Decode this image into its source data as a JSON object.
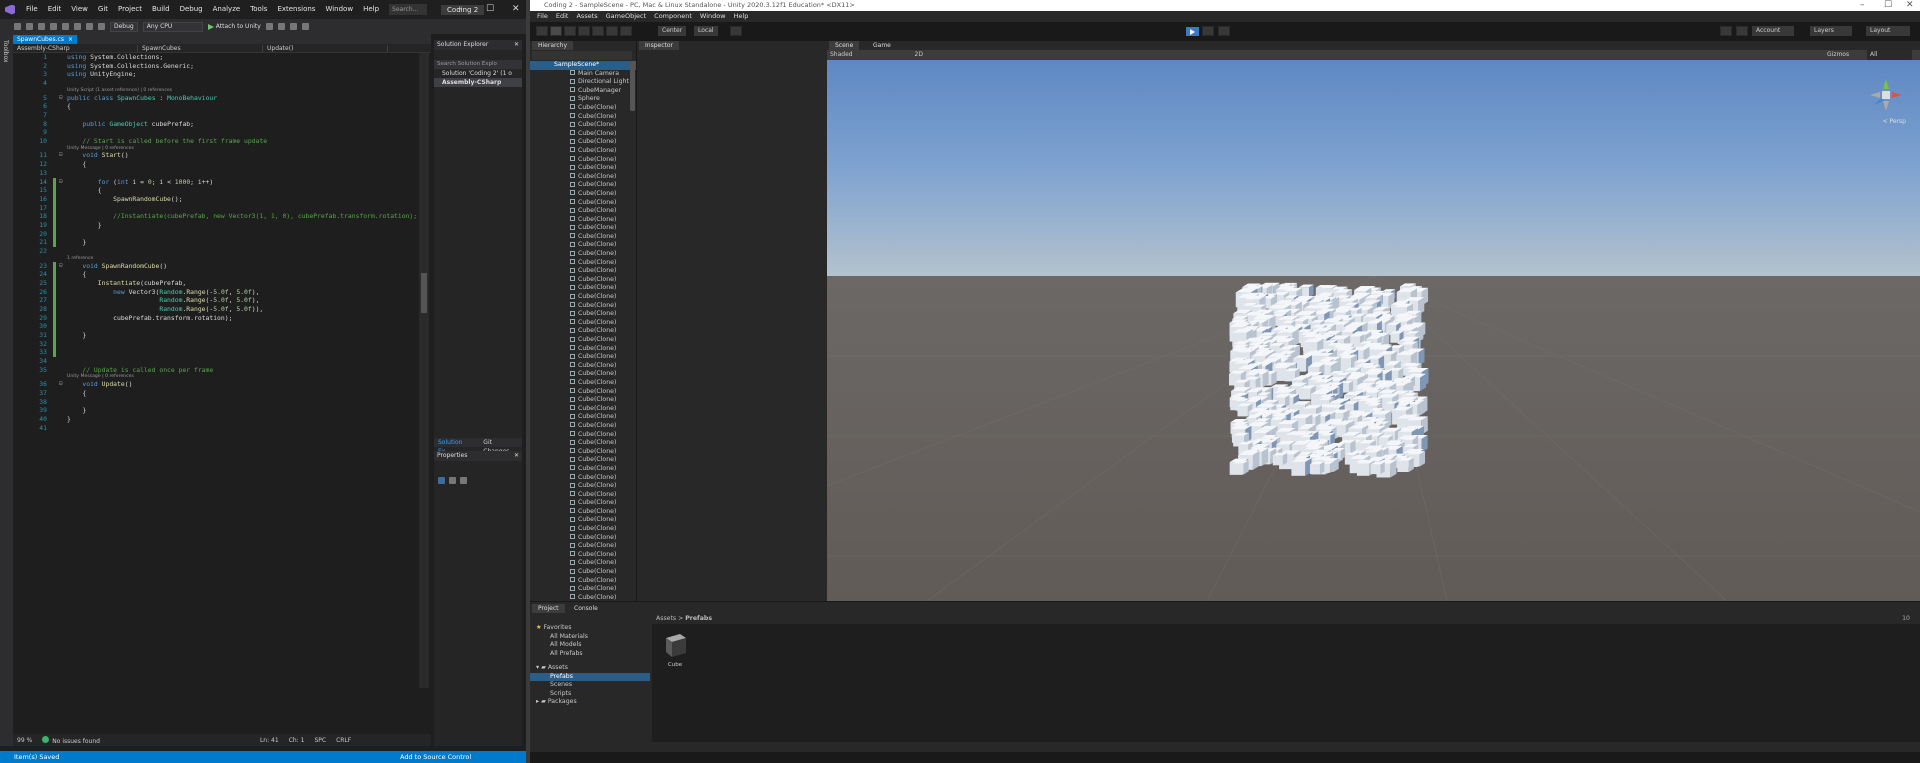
{
  "vs": {
    "menu": [
      "File",
      "Edit",
      "View",
      "Git",
      "Project",
      "Build",
      "Debug",
      "Analyze",
      "Tools",
      "Extensions",
      "Window",
      "Help"
    ],
    "search_placeholder": "Search...",
    "solution_name": "Coding 2",
    "toolbar": {
      "config": "Debug",
      "platform": "Any CPU",
      "attach": "Attach to Unity"
    },
    "toolbox_label": "Toolbox",
    "tab": {
      "file": "SpawnCubes.cs",
      "close": "×"
    },
    "navbar": {
      "project": "Assembly-CSharp",
      "class": "SpawnCubes",
      "member": "Update()"
    },
    "code_lines": [
      {
        "n": "1",
        "lens": ""
      },
      {
        "n": "2",
        "lens": ""
      },
      {
        "n": "3",
        "lens": ""
      },
      {
        "n": "4",
        "lens": ""
      },
      {
        "n": "5",
        "lens": "Unity Script (1 asset reference) | 0 references"
      },
      {
        "n": "6",
        "lens": ""
      },
      {
        "n": "7",
        "lens": ""
      },
      {
        "n": "8",
        "lens": ""
      },
      {
        "n": "9",
        "lens": ""
      },
      {
        "n": "10",
        "lens": ""
      },
      {
        "n": "11",
        "lens": "Unity Message | 0 references"
      },
      {
        "n": "12",
        "lens": ""
      },
      {
        "n": "13",
        "lens": ""
      },
      {
        "n": "14",
        "lens": ""
      },
      {
        "n": "15",
        "lens": ""
      },
      {
        "n": "16",
        "lens": ""
      },
      {
        "n": "17",
        "lens": ""
      },
      {
        "n": "18",
        "lens": ""
      },
      {
        "n": "19",
        "lens": ""
      },
      {
        "n": "20",
        "lens": ""
      },
      {
        "n": "21",
        "lens": ""
      },
      {
        "n": "22",
        "lens": ""
      },
      {
        "n": "23",
        "lens": "1 reference"
      },
      {
        "n": "24",
        "lens": ""
      },
      {
        "n": "25",
        "lens": ""
      },
      {
        "n": "26",
        "lens": ""
      },
      {
        "n": "27",
        "lens": ""
      },
      {
        "n": "28",
        "lens": ""
      },
      {
        "n": "29",
        "lens": ""
      },
      {
        "n": "30",
        "lens": ""
      },
      {
        "n": "31",
        "lens": ""
      },
      {
        "n": "32",
        "lens": ""
      },
      {
        "n": "33",
        "lens": ""
      },
      {
        "n": "34",
        "lens": ""
      },
      {
        "n": "35",
        "lens": ""
      },
      {
        "n": "36",
        "lens": "Unity Message | 0 references"
      },
      {
        "n": "37",
        "lens": ""
      },
      {
        "n": "38",
        "lens": ""
      },
      {
        "n": "39",
        "lens": ""
      },
      {
        "n": "40",
        "lens": ""
      },
      {
        "n": "41",
        "lens": ""
      }
    ],
    "code_text": [
      "using System.Collections;",
      "using System.Collections.Generic;",
      "using UnityEngine;",
      "",
      "public class SpawnCubes : MonoBehaviour",
      "{",
      "",
      "    public GameObject cubePrefab;",
      "",
      "    // Start is called before the first frame update",
      "    void Start()",
      "    {",
      "",
      "        for (int i = 0; i < 1000; i++)",
      "        {",
      "            SpawnRandomCube();",
      "",
      "            //Instantiate(cubePrefab, new Vector3(1, 1, 0), cubePrefab.transform.rotation);",
      "        }",
      "",
      "    }",
      "",
      "    void SpawnRandomCube()",
      "    {",
      "        Instantiate(cubePrefab,",
      "            new Vector3(Random.Range(-5.0f, 5.0f),",
      "                        Random.Range(-5.0f, 5.0f),",
      "                        Random.Range(-5.0f, 5.0f)),",
      "            cubePrefab.transform.rotation);",
      "",
      "    }",
      "",
      "",
      "",
      "    // Update is called once per frame",
      "    void Update()",
      "    {",
      "",
      "    }",
      "}",
      ""
    ],
    "editor_status": {
      "zoom": "99 %",
      "issues": "No issues found",
      "ln": "Ln: 41",
      "ch": "Ch: 1",
      "spc": "SPC",
      "crlf": "CRLF"
    },
    "solution_explorer": {
      "title": "Solution Explorer",
      "search": "Search Solution Explo",
      "items": [
        "Solution 'Coding 2' (1 o",
        "Assembly-CSharp"
      ],
      "tabs": [
        "Solution Ex...",
        "Git Changes"
      ]
    },
    "properties_title": "Properties",
    "status": {
      "left": "Item(s) Saved",
      "right": "Add to Source Control"
    }
  },
  "unity": {
    "title": "Coding 2 - SampleScene - PC, Mac & Linux Standalone - Unity 2020.3.12f1 Education* <DX11>",
    "menu": [
      "File",
      "Edit",
      "Assets",
      "GameObject",
      "Component",
      "Window",
      "Help"
    ],
    "toolbar": {
      "center": "Center",
      "local": "Local",
      "account": "Account",
      "layers": "Layers",
      "layout": "Layout"
    },
    "hierarchy": {
      "tab": "Hierarchy",
      "scene": "SampleScene*",
      "objects": [
        "Main Camera",
        "Directional Light",
        "CubeManager",
        "Sphere"
      ],
      "clone_label": "Cube(Clone)",
      "clone_rows_visible": 58
    },
    "inspector_tab": "Inspector",
    "scene_tabs": [
      "Scene",
      "Game"
    ],
    "scene_toolbar": {
      "shading": "Shaded",
      "mode": "2D",
      "gizmos": "Gizmos",
      "search": "All"
    },
    "gizmo_label": "< Persp",
    "project": {
      "tabs": [
        "Project",
        "Console"
      ],
      "favorites": {
        "label": "Favorites",
        "items": [
          "All Materials",
          "All Models",
          "All Prefabs"
        ]
      },
      "assets": {
        "label": "Assets",
        "items": [
          "Prefabs",
          "Scenes",
          "Scripts"
        ]
      },
      "packages": "Packages",
      "breadcrumb": {
        "root": "Assets",
        "sep": ">",
        "current": "Prefabs"
      },
      "asset_item": "Cube",
      "count": "10"
    }
  },
  "colors": {
    "vs_accent": "#007acc",
    "unity_play": "#3a78c8",
    "keyword": "#569cd6",
    "type": "#4ec9b0",
    "comment": "#57a64a"
  }
}
